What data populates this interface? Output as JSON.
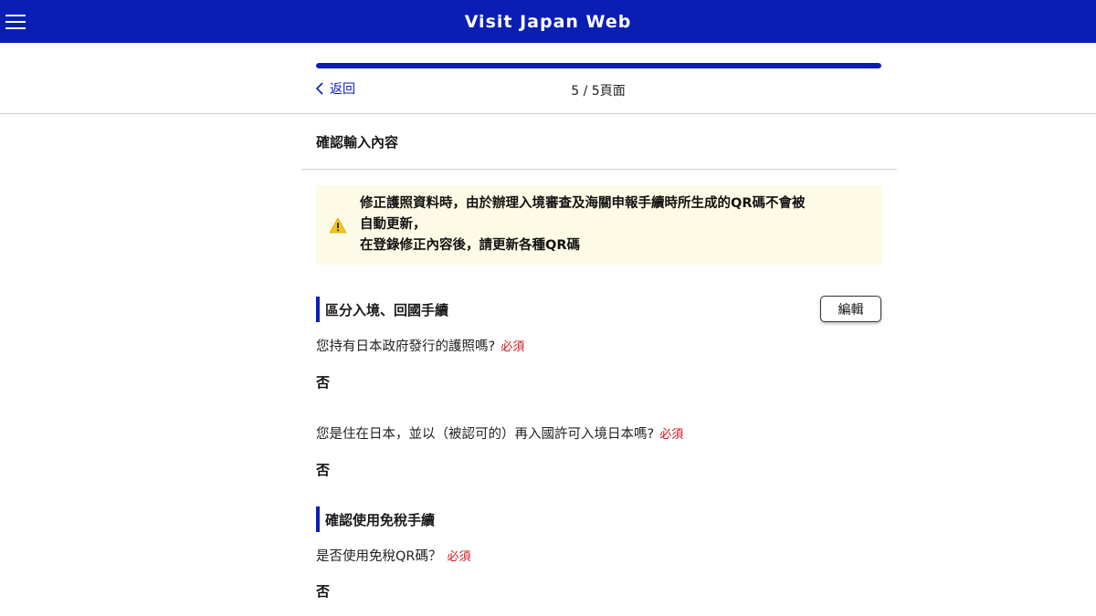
{
  "header": {
    "title": "Visit Japan Web",
    "menu_icon": "hamburger-menu-icon"
  },
  "progress": {
    "current": 5,
    "total": 5,
    "fraction": 1.0
  },
  "nav": {
    "back_label": "返回",
    "page_indicator": "5 / 5頁面"
  },
  "page": {
    "section_title": "確認輸入內容"
  },
  "warning": {
    "icon": "warning-triangle-icon",
    "line1": "修正護照資料時，由於辦理入境審查及海關申報手續時所生成的QR碼不會被",
    "line2": "自動更新，",
    "line3": "在登錄修正內容後，請更新各種QR碼"
  },
  "groups": [
    {
      "title": "區分入境、回國手續",
      "edit_label": "編輯",
      "items": [
        {
          "question": "您持有日本政府發行的護照嗎?",
          "required": "必須",
          "answer": "否"
        },
        {
          "question": "您是住在日本，並以（被認可的）再入國許可入境日本嗎?",
          "required": "必須",
          "answer": "否"
        }
      ]
    },
    {
      "title": "確認使用免稅手續",
      "items": [
        {
          "question": "是否使用免稅QR碼？",
          "required": "必須",
          "answer": "否"
        }
      ]
    }
  ],
  "colors": {
    "brand": "#0a1eb4",
    "required": "#d0121b",
    "warning_bg": "#fdfbe6"
  }
}
